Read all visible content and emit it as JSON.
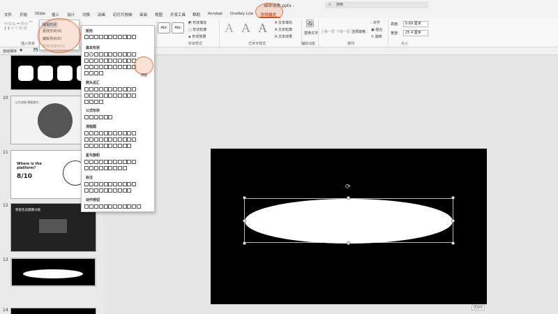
{
  "window": {
    "title": "媒体镜像.pptx - ",
    "search_placeholder": "搜索"
  },
  "tabs": [
    "文件",
    "开始",
    "iSlide",
    "插入",
    "设计",
    "切换",
    "动画",
    "幻灯片放映",
    "审阅",
    "视图",
    "开发工具",
    "帮助",
    "Acrobat",
    "OneKey Lite",
    "形状格式"
  ],
  "ribbon": {
    "groups": {
      "insert_shapes": "插入形状",
      "shape_styles": "形状样式",
      "wordart": "艺术字样式",
      "accessibility": "辅助功能",
      "arrange": "排列",
      "size": "大小"
    },
    "fill": "形状填充",
    "outline": "形状轮廓",
    "effects": "形状效果",
    "text_fill": "文本填充",
    "text_outline": "文本轮廓",
    "text_effects": "文本效果",
    "alt_text": "替换文字",
    "bring_forward": "上移一层",
    "send_backward": "下移一层",
    "selection_pane": "选择窗格",
    "align": "对齐",
    "group": "组合",
    "rotate": "旋转",
    "height_label": "高度:",
    "height_value": "5.69 厘米",
    "width_label": "宽度:",
    "width_value": "25.4 厘米",
    "style_abc": "Abc",
    "wordart_a": "A"
  },
  "autosave": "自动保存",
  "edit_shape_popup": {
    "title": "编辑形状",
    "change_shape": "更改形状(N)",
    "edit_points": "编辑顶点(E)",
    "reroute": "重排连接符(R)"
  },
  "shape_menu": {
    "categories": [
      "矩形",
      "基本形状",
      "箭头总汇",
      "公式形状",
      "流程图",
      "星与旗帜",
      "标注",
      "动作按钮"
    ],
    "tooltip": "椭圆"
  },
  "slides": [
    {
      "number": "10",
      "title": "以生态链-模板格式"
    },
    {
      "number": "11",
      "heading": "Where is the platform?",
      "stat": "8/10"
    },
    {
      "number": "12",
      "title": "保留生态健康分级"
    },
    {
      "number": "13"
    },
    {
      "number": "14"
    }
  ],
  "status": {
    "ctrl_badge": "(Ctrl)"
  }
}
